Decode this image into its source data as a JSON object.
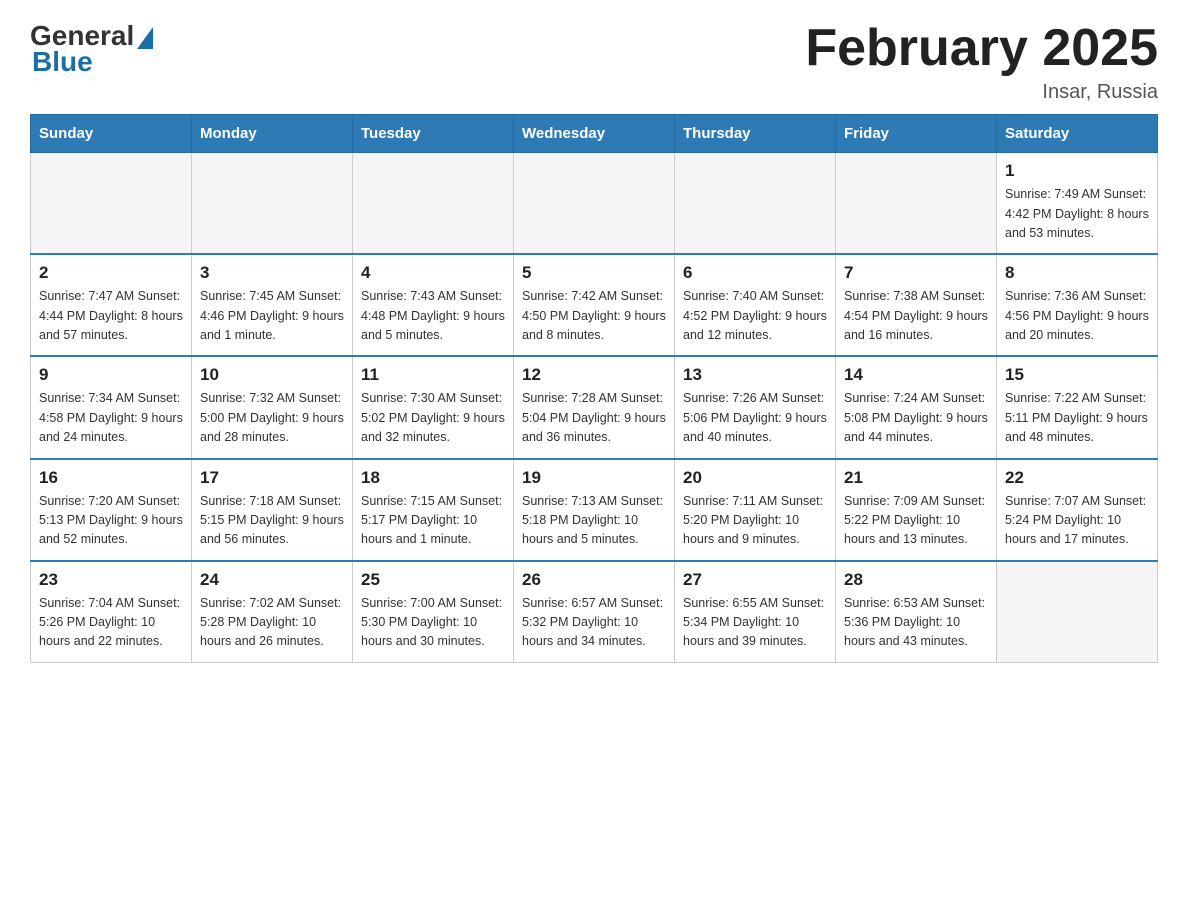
{
  "header": {
    "logo_general": "General",
    "logo_blue": "Blue",
    "month_title": "February 2025",
    "location": "Insar, Russia"
  },
  "days_of_week": [
    "Sunday",
    "Monday",
    "Tuesday",
    "Wednesday",
    "Thursday",
    "Friday",
    "Saturday"
  ],
  "weeks": [
    [
      {
        "day": "",
        "info": ""
      },
      {
        "day": "",
        "info": ""
      },
      {
        "day": "",
        "info": ""
      },
      {
        "day": "",
        "info": ""
      },
      {
        "day": "",
        "info": ""
      },
      {
        "day": "",
        "info": ""
      },
      {
        "day": "1",
        "info": "Sunrise: 7:49 AM\nSunset: 4:42 PM\nDaylight: 8 hours\nand 53 minutes."
      }
    ],
    [
      {
        "day": "2",
        "info": "Sunrise: 7:47 AM\nSunset: 4:44 PM\nDaylight: 8 hours\nand 57 minutes."
      },
      {
        "day": "3",
        "info": "Sunrise: 7:45 AM\nSunset: 4:46 PM\nDaylight: 9 hours\nand 1 minute."
      },
      {
        "day": "4",
        "info": "Sunrise: 7:43 AM\nSunset: 4:48 PM\nDaylight: 9 hours\nand 5 minutes."
      },
      {
        "day": "5",
        "info": "Sunrise: 7:42 AM\nSunset: 4:50 PM\nDaylight: 9 hours\nand 8 minutes."
      },
      {
        "day": "6",
        "info": "Sunrise: 7:40 AM\nSunset: 4:52 PM\nDaylight: 9 hours\nand 12 minutes."
      },
      {
        "day": "7",
        "info": "Sunrise: 7:38 AM\nSunset: 4:54 PM\nDaylight: 9 hours\nand 16 minutes."
      },
      {
        "day": "8",
        "info": "Sunrise: 7:36 AM\nSunset: 4:56 PM\nDaylight: 9 hours\nand 20 minutes."
      }
    ],
    [
      {
        "day": "9",
        "info": "Sunrise: 7:34 AM\nSunset: 4:58 PM\nDaylight: 9 hours\nand 24 minutes."
      },
      {
        "day": "10",
        "info": "Sunrise: 7:32 AM\nSunset: 5:00 PM\nDaylight: 9 hours\nand 28 minutes."
      },
      {
        "day": "11",
        "info": "Sunrise: 7:30 AM\nSunset: 5:02 PM\nDaylight: 9 hours\nand 32 minutes."
      },
      {
        "day": "12",
        "info": "Sunrise: 7:28 AM\nSunset: 5:04 PM\nDaylight: 9 hours\nand 36 minutes."
      },
      {
        "day": "13",
        "info": "Sunrise: 7:26 AM\nSunset: 5:06 PM\nDaylight: 9 hours\nand 40 minutes."
      },
      {
        "day": "14",
        "info": "Sunrise: 7:24 AM\nSunset: 5:08 PM\nDaylight: 9 hours\nand 44 minutes."
      },
      {
        "day": "15",
        "info": "Sunrise: 7:22 AM\nSunset: 5:11 PM\nDaylight: 9 hours\nand 48 minutes."
      }
    ],
    [
      {
        "day": "16",
        "info": "Sunrise: 7:20 AM\nSunset: 5:13 PM\nDaylight: 9 hours\nand 52 minutes."
      },
      {
        "day": "17",
        "info": "Sunrise: 7:18 AM\nSunset: 5:15 PM\nDaylight: 9 hours\nand 56 minutes."
      },
      {
        "day": "18",
        "info": "Sunrise: 7:15 AM\nSunset: 5:17 PM\nDaylight: 10 hours\nand 1 minute."
      },
      {
        "day": "19",
        "info": "Sunrise: 7:13 AM\nSunset: 5:18 PM\nDaylight: 10 hours\nand 5 minutes."
      },
      {
        "day": "20",
        "info": "Sunrise: 7:11 AM\nSunset: 5:20 PM\nDaylight: 10 hours\nand 9 minutes."
      },
      {
        "day": "21",
        "info": "Sunrise: 7:09 AM\nSunset: 5:22 PM\nDaylight: 10 hours\nand 13 minutes."
      },
      {
        "day": "22",
        "info": "Sunrise: 7:07 AM\nSunset: 5:24 PM\nDaylight: 10 hours\nand 17 minutes."
      }
    ],
    [
      {
        "day": "23",
        "info": "Sunrise: 7:04 AM\nSunset: 5:26 PM\nDaylight: 10 hours\nand 22 minutes."
      },
      {
        "day": "24",
        "info": "Sunrise: 7:02 AM\nSunset: 5:28 PM\nDaylight: 10 hours\nand 26 minutes."
      },
      {
        "day": "25",
        "info": "Sunrise: 7:00 AM\nSunset: 5:30 PM\nDaylight: 10 hours\nand 30 minutes."
      },
      {
        "day": "26",
        "info": "Sunrise: 6:57 AM\nSunset: 5:32 PM\nDaylight: 10 hours\nand 34 minutes."
      },
      {
        "day": "27",
        "info": "Sunrise: 6:55 AM\nSunset: 5:34 PM\nDaylight: 10 hours\nand 39 minutes."
      },
      {
        "day": "28",
        "info": "Sunrise: 6:53 AM\nSunset: 5:36 PM\nDaylight: 10 hours\nand 43 minutes."
      },
      {
        "day": "",
        "info": ""
      }
    ]
  ]
}
